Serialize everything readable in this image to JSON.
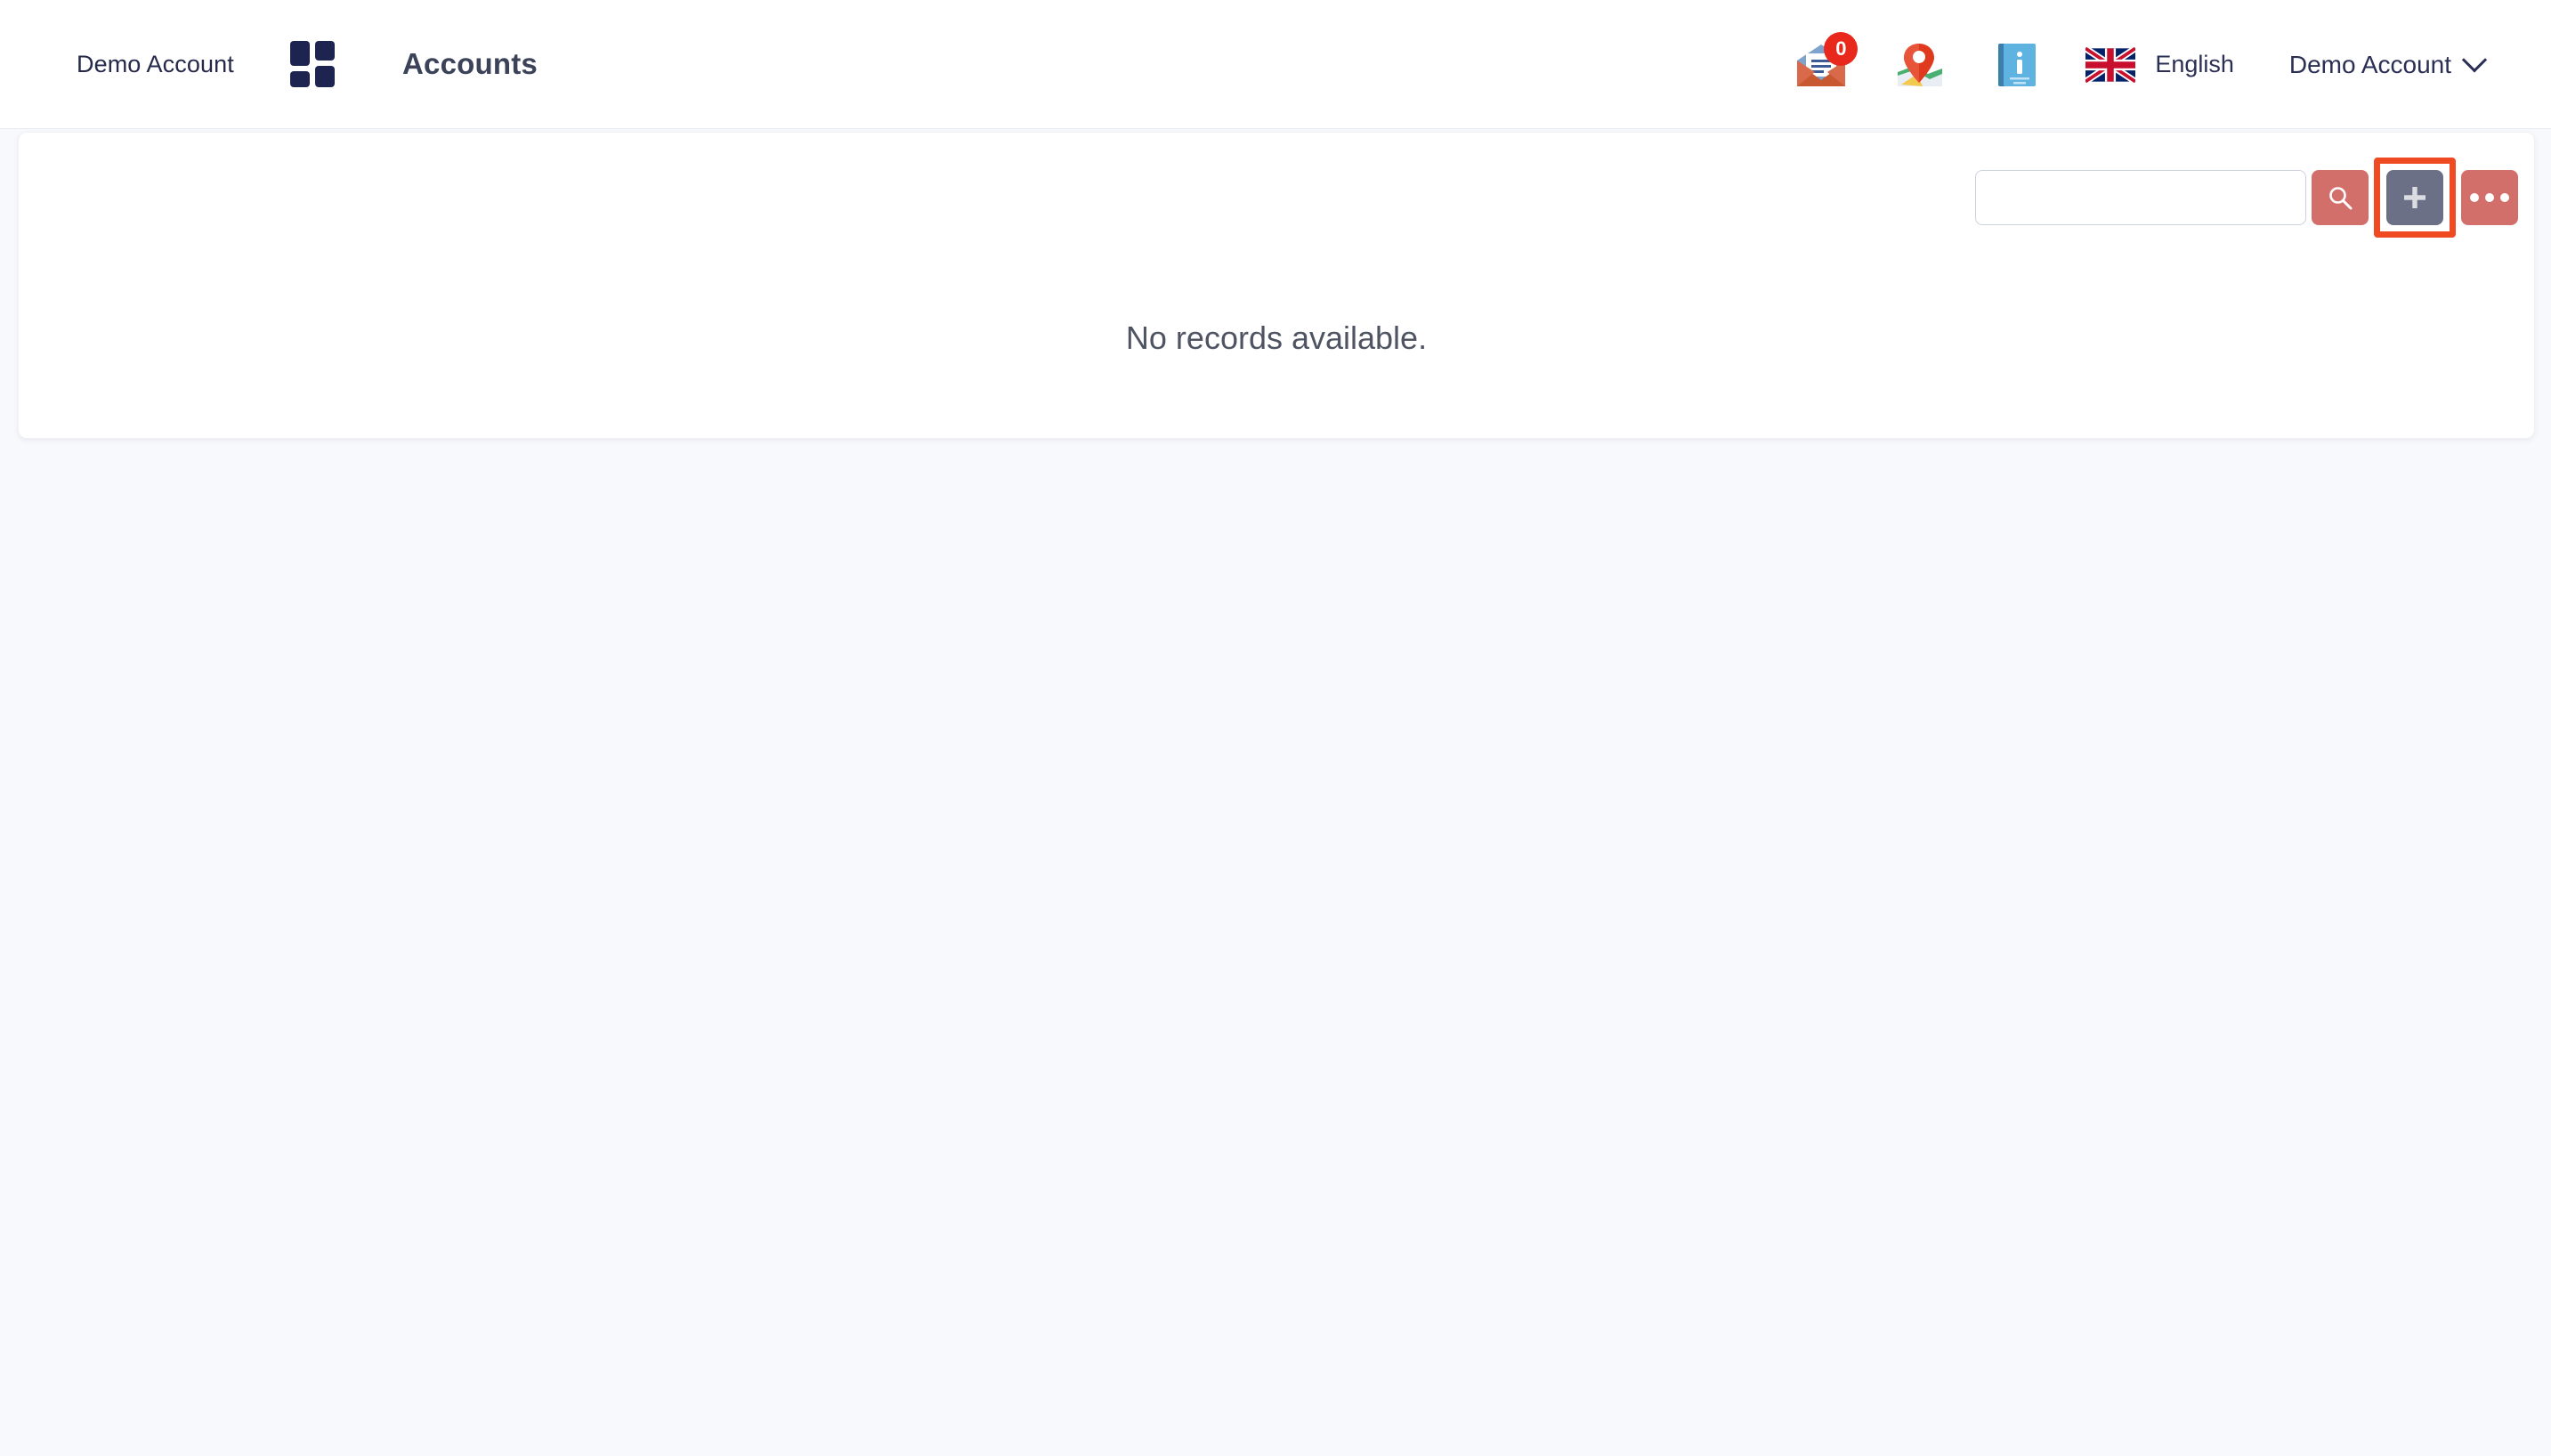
{
  "header": {
    "brand": "Demo Account",
    "grid_icon": "grid-apps-icon",
    "title": "Accounts",
    "messages": {
      "icon": "envelope-icon",
      "badge": "0"
    },
    "map": {
      "icon": "map-pin-icon"
    },
    "info": {
      "icon": "info-book-icon"
    },
    "language": {
      "flag_icon": "uk-flag-icon",
      "label": "English"
    },
    "user": {
      "label": "Demo Account",
      "chevron_icon": "chevron-down-icon"
    }
  },
  "toolbar": {
    "search_value": "",
    "search_placeholder": "",
    "search_button_icon": "search-icon",
    "add_button_icon": "plus-icon",
    "more_button_icon": "ellipsis-icon"
  },
  "main": {
    "empty_message": "No records available."
  },
  "colors": {
    "accent_red": "#d36f6b",
    "highlight": "#f04a22",
    "gray_button": "#6b7086",
    "brand_navy": "#25294a",
    "page_bg": "#f8f9fc"
  }
}
